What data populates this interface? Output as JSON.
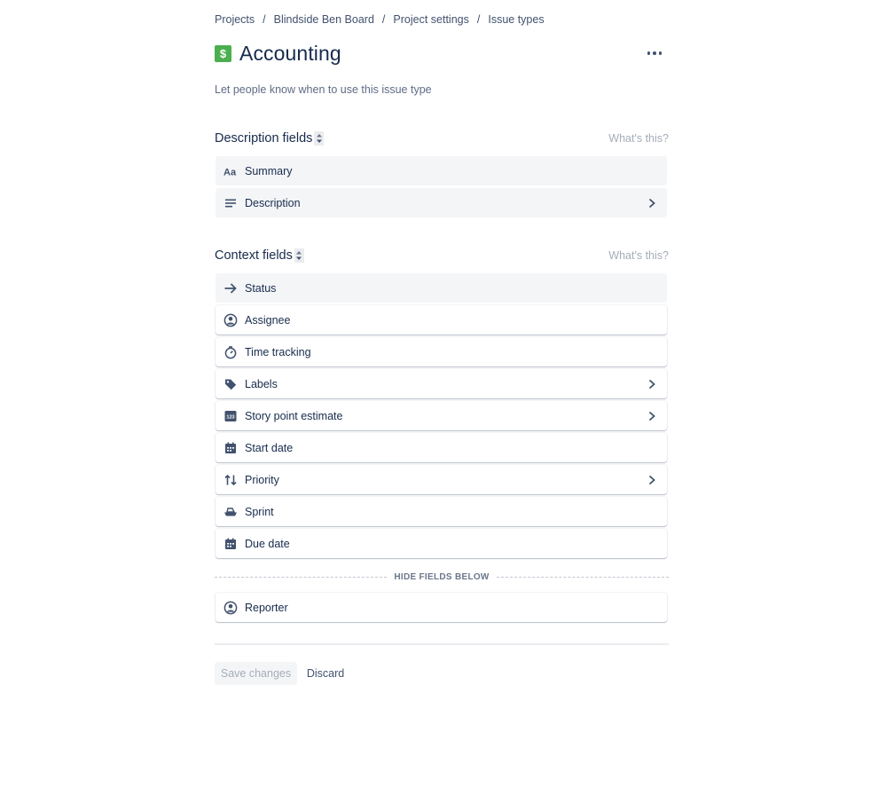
{
  "breadcrumb": {
    "items": [
      "Projects",
      "Blindside Ben Board",
      "Project settings",
      "Issue types"
    ],
    "separator": "/"
  },
  "header": {
    "title": "Accounting",
    "icon": "dollar-icon",
    "icon_glyph": "$",
    "icon_color": "#4bae4f"
  },
  "description_prompt": "Let people know when to use this issue type",
  "description_fields": {
    "title": "Description fields",
    "whats_this": "What's this?",
    "items": [
      {
        "label": "Summary",
        "icon": "text-format-icon",
        "locked": true,
        "has_chevron": false
      },
      {
        "label": "Description",
        "icon": "paragraph-lines-icon",
        "locked": true,
        "has_chevron": true
      }
    ]
  },
  "context_fields": {
    "title": "Context fields",
    "whats_this": "What's this?",
    "items": [
      {
        "label": "Status",
        "icon": "arrow-right-icon",
        "locked": true,
        "has_chevron": false
      },
      {
        "label": "Assignee",
        "icon": "person-circle-icon",
        "locked": false,
        "has_chevron": false
      },
      {
        "label": "Time tracking",
        "icon": "stopwatch-icon",
        "locked": false,
        "has_chevron": false
      },
      {
        "label": "Labels",
        "icon": "tag-icon",
        "locked": false,
        "has_chevron": true
      },
      {
        "label": "Story point estimate",
        "icon": "number-123-icon",
        "locked": false,
        "has_chevron": true
      },
      {
        "label": "Start date",
        "icon": "calendar-icon",
        "locked": false,
        "has_chevron": false
      },
      {
        "label": "Priority",
        "icon": "sort-arrows-icon",
        "locked": false,
        "has_chevron": true
      },
      {
        "label": "Sprint",
        "icon": "boat-icon",
        "locked": false,
        "has_chevron": false
      },
      {
        "label": "Due date",
        "icon": "calendar-icon",
        "locked": false,
        "has_chevron": false
      }
    ]
  },
  "hide_fields_label": "HIDE FIELDS BELOW",
  "hidden_fields": {
    "items": [
      {
        "label": "Reporter",
        "icon": "person-circle-icon",
        "locked": false,
        "has_chevron": false
      }
    ]
  },
  "actions": {
    "save_label": "Save changes",
    "discard_label": "Discard"
  }
}
